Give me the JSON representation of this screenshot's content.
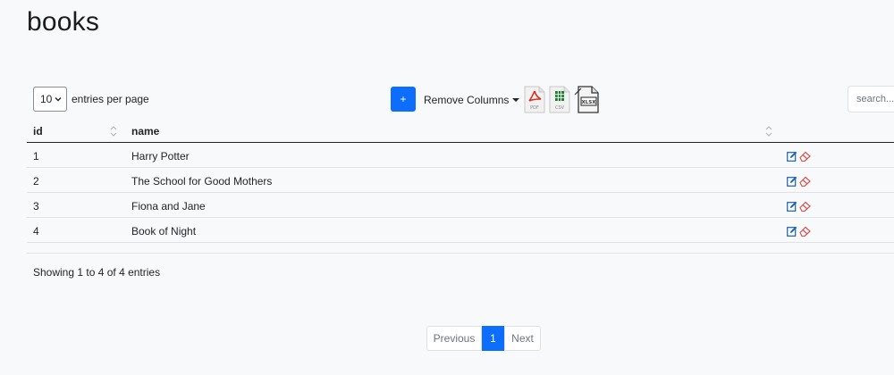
{
  "page": {
    "title": "books"
  },
  "toolbar": {
    "per_page_value": "10",
    "per_page_label": "entries per page",
    "add_label": "+",
    "remove_columns_label": "Remove Columns",
    "export_pdf_label": "PDF",
    "export_csv_label": "CSV",
    "export_xlsx_label": "XLSX",
    "search_placeholder": "search..."
  },
  "table": {
    "columns": [
      "id",
      "name"
    ],
    "rows": [
      {
        "id": "1",
        "name": "Harry Potter"
      },
      {
        "id": "2",
        "name": "The School for Good Mothers"
      },
      {
        "id": "3",
        "name": "Fiona and Jane"
      },
      {
        "id": "4",
        "name": "Book of Night"
      }
    ]
  },
  "summary": "Showing 1 to 4 of 4 entries",
  "pagination": {
    "previous": "Previous",
    "current": "1",
    "next": "Next"
  },
  "colors": {
    "primary": "#0d6efd",
    "edit_icon": "#1a5fb4",
    "delete_icon": "#d9534f",
    "pdf": "#d93025",
    "csv": "#1e7e34"
  }
}
